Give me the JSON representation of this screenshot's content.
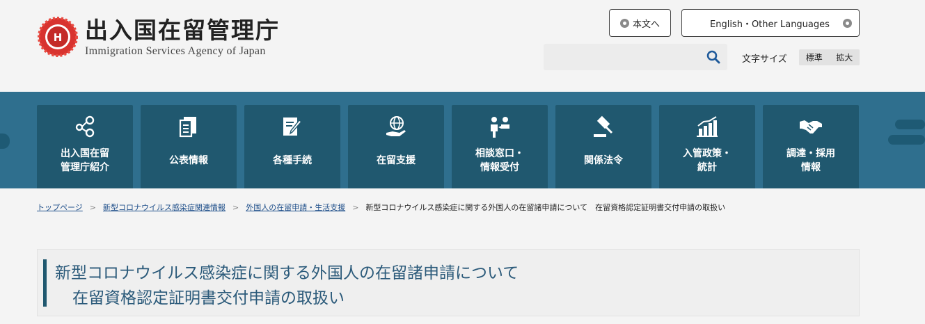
{
  "header": {
    "site_title": "出入国在留管理庁",
    "site_subtitle": "Immigration Services Agency of Japan",
    "skip_label": "本文へ",
    "language_label": "English・Other Languages",
    "search": {
      "placeholder": ""
    },
    "font_size": {
      "label": "文字サイズ",
      "standard": "標準",
      "large": "拡大"
    }
  },
  "nav": {
    "items": [
      {
        "label": "出入国在留\n管理庁紹介",
        "icon": "people-network-icon"
      },
      {
        "label": "公表情報",
        "icon": "documents-icon"
      },
      {
        "label": "各種手続",
        "icon": "form-pen-icon"
      },
      {
        "label": "在留支援",
        "icon": "globe-hand-icon"
      },
      {
        "label": "相談窓口・\n情報受付",
        "icon": "consultation-people-icon"
      },
      {
        "label": "関係法令",
        "icon": "gavel-icon"
      },
      {
        "label": "入管政策・\n統計",
        "icon": "bar-chart-icon"
      },
      {
        "label": "調達・採用\n情報",
        "icon": "handshake-icon"
      }
    ]
  },
  "breadcrumb": {
    "items": [
      "トップページ",
      "新型コロナウイルス感染症関連情報",
      "外国人の在留申請・生活支援"
    ],
    "current": "新型コロナウイルス感染症に関する外国人の在留諸申請について　在留資格認定証明書交付申請の取扱い"
  },
  "page": {
    "title_line1": "新型コロナウイルス感染症に関する外国人の在留諸申請について",
    "title_line2": "在留資格認定証明書交付申請の取扱い"
  },
  "colors": {
    "nav_background": "#2f6f8e",
    "nav_tab": "#20586f",
    "title_text": "#2b5a7a",
    "link": "#1f4f8a"
  }
}
